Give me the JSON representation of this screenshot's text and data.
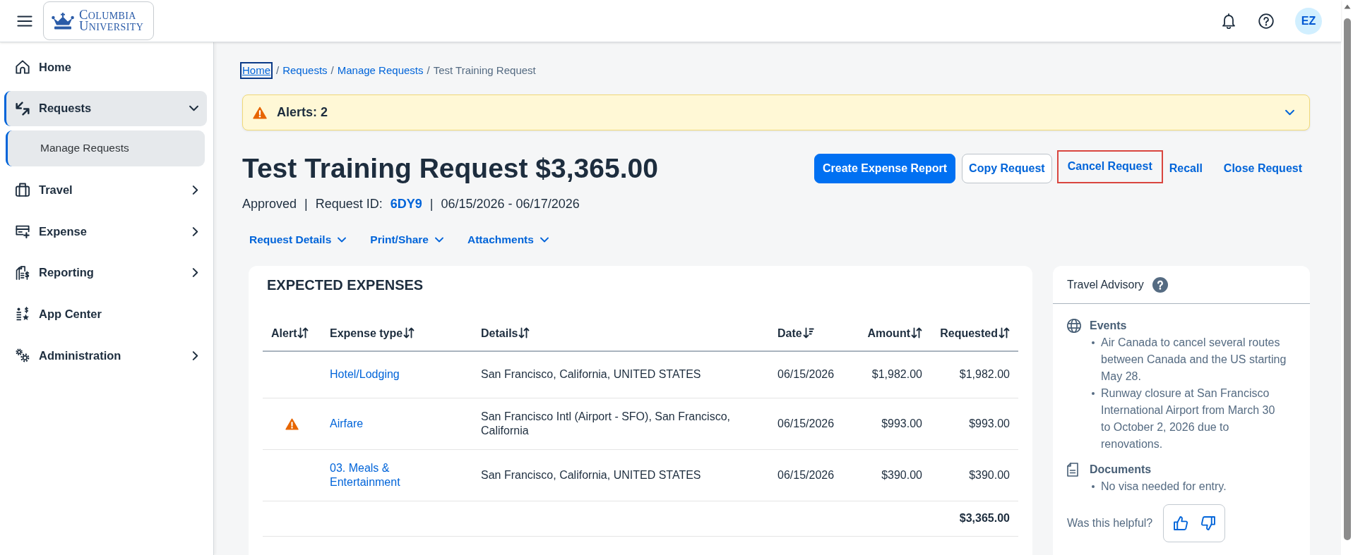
{
  "header": {
    "logo": {
      "lines": [
        "COLUMBIA",
        "UNIVERSITY"
      ]
    },
    "avatar": {
      "initials": "EZ"
    }
  },
  "sidebar": {
    "items": [
      {
        "label": "Home",
        "selected": false
      },
      {
        "label": "Requests",
        "selected": true,
        "expanded": true,
        "children": [
          {
            "label": "Manage Requests",
            "selected": true
          }
        ]
      },
      {
        "label": "Travel",
        "selected": false,
        "expanded": false
      },
      {
        "label": "Expense",
        "selected": false,
        "expanded": false
      },
      {
        "label": "Reporting",
        "selected": false,
        "expanded": false
      },
      {
        "label": "App Center",
        "selected": false
      },
      {
        "label": "Administration",
        "selected": false,
        "expanded": false
      }
    ]
  },
  "breadcrumb": [
    {
      "kind": "link",
      "text": "Home",
      "focused": true
    },
    {
      "kind": "separator",
      "text": "/"
    },
    {
      "kind": "link",
      "text": "Requests",
      "focused": false
    },
    {
      "kind": "separator",
      "text": "/"
    },
    {
      "kind": "link",
      "text": "Manage Requests",
      "focused": false
    },
    {
      "kind": "separator",
      "text": "/"
    },
    {
      "kind": "current",
      "text": "Test Training Request"
    }
  ],
  "alerts": {
    "label": "Alerts: 2",
    "expanded": false
  },
  "title": "Test Training Request $3,365.00",
  "actions": [
    {
      "label": "Create Expense Report",
      "kind": "primary",
      "highlighted": false
    },
    {
      "label": "Copy Request",
      "kind": "outlined",
      "highlighted": false
    },
    {
      "label": "Cancel Request",
      "kind": "transparent",
      "highlighted": true
    },
    {
      "label": "Recall",
      "kind": "transparent",
      "highlighted": false
    },
    {
      "label": "Close Request",
      "kind": "transparent",
      "highlighted": false
    }
  ],
  "meta": [
    {
      "kind": "status",
      "text": "Approved"
    },
    {
      "kind": "separator",
      "text": "|"
    },
    {
      "kind": "label",
      "text": "Request ID:"
    },
    {
      "kind": "link",
      "text": "6DY9"
    },
    {
      "kind": "separator",
      "text": "|"
    },
    {
      "kind": "dates",
      "text": "06/15/2026 - 06/17/2026"
    }
  ],
  "menus": [
    {
      "label": "Request Details",
      "expanded": false
    },
    {
      "label": "Print/Share",
      "expanded": false
    },
    {
      "label": "Attachments",
      "expanded": false
    }
  ],
  "expected_expenses": {
    "title": "EXPECTED EXPENSES",
    "columns": [
      {
        "label": "Alert",
        "sorted": false
      },
      {
        "label": "Expense type",
        "sorted": false
      },
      {
        "label": "Details",
        "sorted": false
      },
      {
        "label": "Date",
        "sorted": true
      },
      {
        "label": "Amount",
        "sorted": false
      },
      {
        "label": "Requested",
        "sorted": false
      }
    ],
    "rows": [
      {
        "alert": false,
        "expense_type": "Hotel/Lodging",
        "details": "San Francisco, California, UNITED STATES",
        "date": "06/15/2026",
        "amount": "$1,982.00",
        "requested": "$1,982.00"
      },
      {
        "alert": true,
        "expense_type": "Airfare",
        "details": "San Francisco Intl (Airport - SFO), San Francisco, California",
        "date": "06/15/2026",
        "amount": "$993.00",
        "requested": "$993.00"
      },
      {
        "alert": false,
        "expense_type": "03. Meals & Entertainment",
        "details": "San Francisco, California, UNITED STATES",
        "date": "06/15/2026",
        "amount": "$390.00",
        "requested": "$390.00"
      }
    ],
    "total": "$3,365.00"
  },
  "travel_advisory": {
    "title": "Travel Advisory",
    "sections": [
      {
        "heading": "Events",
        "items": [
          "Air Canada to cancel several routes between Canada and the US starting May 28.",
          "Runway closure at San Francisco International Airport from March 30 to October 2, 2026 due to renovations."
        ]
      },
      {
        "heading": "Documents",
        "items": [
          "No visa needed for entry."
        ]
      }
    ],
    "feedback": {
      "question": "Was this helpful?"
    }
  }
}
